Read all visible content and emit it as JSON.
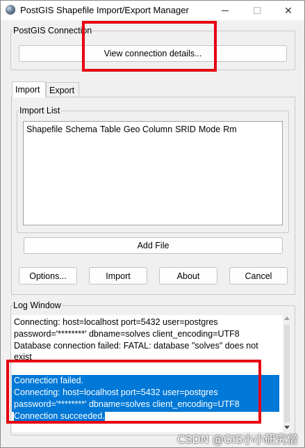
{
  "window": {
    "title": "PostGIS Shapefile Import/Export Manager",
    "icon": "postgis-elephant-globe-icon",
    "controls": {
      "minimize": "",
      "maximize": "",
      "close": "✕"
    }
  },
  "connection": {
    "group_label": "PostGIS Connection",
    "view_details_label": "View connection details..."
  },
  "tabs": [
    {
      "label": "Import",
      "selected": true
    },
    {
      "label": "Export",
      "selected": false
    }
  ],
  "import_list": {
    "group_label": "Import List",
    "columns": [
      "Shapefile",
      "Schema",
      "Table",
      "Geo Column",
      "SRID",
      "Mode",
      "Rm"
    ],
    "add_file_label": "Add File"
  },
  "actions": {
    "options_label": "Options...",
    "import_label": "Import",
    "about_label": "About",
    "cancel_label": "Cancel"
  },
  "log": {
    "group_label": "Log Window",
    "lines": [
      "Connecting:  host=localhost port=5432 user=postgres",
      "password='********' dbname=solves client_encoding=UTF8",
      "Database connection failed: FATAL:  database \"solves\" does not",
      "exist",
      "Connection failed.",
      "Connecting:  host=localhost port=5432 user=postgres",
      "password='********' dbname=solves client_encoding=UTF8",
      "Connection succeeded."
    ]
  },
  "watermark": "CSDN @GIS小小研究僧",
  "colors": {
    "selection": "#0078d7",
    "annotation_box": "#e60012"
  }
}
